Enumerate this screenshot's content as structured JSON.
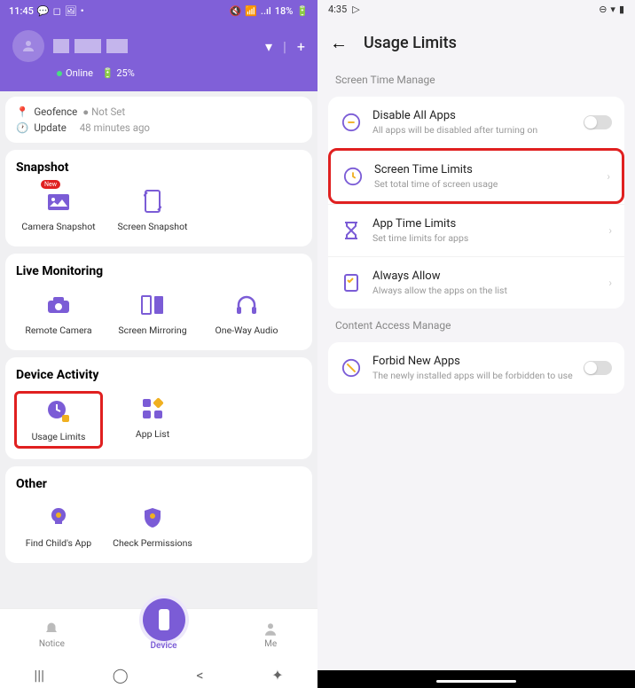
{
  "left": {
    "status": {
      "time": "11:45",
      "battery": "18%",
      "signal": "..ıl"
    },
    "header": {
      "online": "Online",
      "battery_pct": "25%",
      "dropdown": "▾",
      "add": "+"
    },
    "info": {
      "geofence_label": "Geofence",
      "geofence_value": "Not Set",
      "update_label": "Update",
      "update_value": "48 minutes ago"
    },
    "sections": {
      "snapshot": {
        "title": "Snapshot",
        "camera": "Camera Snapshot",
        "screen": "Screen Snapshot",
        "new": "New"
      },
      "live": {
        "title": "Live Monitoring",
        "remote": "Remote Camera",
        "mirror": "Screen Mirroring",
        "audio": "One-Way Audio"
      },
      "activity": {
        "title": "Device Activity",
        "usage": "Usage Limits",
        "applist": "App List"
      },
      "other": {
        "title": "Other",
        "find": "Find Child's App",
        "check": "Check Permissions"
      }
    },
    "nav": {
      "notice": "Notice",
      "device": "Device",
      "me": "Me"
    }
  },
  "right": {
    "status": {
      "time": "4:35"
    },
    "title": "Usage Limits",
    "section1": "Screen Time Manage",
    "section2": "Content Access Manage",
    "items": {
      "disable": {
        "title": "Disable All Apps",
        "desc": "All apps will be disabled after turning on"
      },
      "screen_limits": {
        "title": "Screen Time Limits",
        "desc": "Set total time of screen usage"
      },
      "app_limits": {
        "title": "App Time Limits",
        "desc": "Set time limits for apps"
      },
      "always": {
        "title": "Always Allow",
        "desc": "Always allow the apps on the list"
      },
      "forbid": {
        "title": "Forbid New Apps",
        "desc": "The newly installed apps will be forbidden to use"
      }
    }
  }
}
